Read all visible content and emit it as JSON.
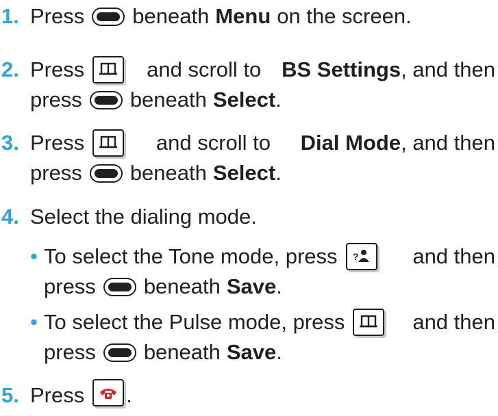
{
  "steps": [
    {
      "number": "1.",
      "parts": {
        "a": "Press",
        "b": "beneath",
        "menu": "Menu",
        "c": "on the screen."
      },
      "icons": [
        "softkey-icon"
      ]
    },
    {
      "number": "2.",
      "parts": {
        "a": "Press",
        "b": "and scroll to",
        "target": "BS Settings",
        "c": ", and then",
        "d": "press",
        "e": "beneath",
        "select": "Select",
        "f": "."
      },
      "icons": [
        "phonebook-key-icon",
        "softkey-icon"
      ]
    },
    {
      "number": "3.",
      "parts": {
        "a": "Press",
        "b": "and scroll to",
        "target": "Dial Mode",
        "c": ", and then",
        "d": "press",
        "e": "beneath",
        "select": "Select",
        "f": "."
      },
      "icons": [
        "phonebook-key-icon",
        "softkey-icon"
      ]
    },
    {
      "number": "4.",
      "text": "Select the dialing mode."
    },
    {
      "number": "5.",
      "parts": {
        "a": "Press",
        "f": "."
      },
      "icons": [
        "end-call-key-icon"
      ]
    }
  ],
  "bullets": [
    {
      "marker": "•",
      "parts": {
        "a": "To select the Tone mode, press",
        "b": "and then",
        "d": "press",
        "e": "beneath",
        "save": "Save",
        "f": "."
      },
      "icons": [
        "contacts-key-icon",
        "softkey-icon"
      ]
    },
    {
      "marker": "•",
      "parts": {
        "a": "To select the Pulse mode, press",
        "b": "and then",
        "d": "press",
        "e": "beneath",
        "save": "Save",
        "f": "."
      },
      "icons": [
        "phonebook-key-icon",
        "softkey-icon"
      ]
    }
  ],
  "colors": {
    "accent": "#2ea3dc",
    "text": "#231f20",
    "end_call_red": "#d9232d"
  }
}
